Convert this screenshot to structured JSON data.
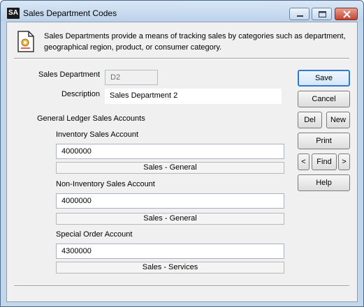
{
  "window": {
    "badge": "SA",
    "title": "Sales Department Codes"
  },
  "info": {
    "text": "Sales Departments provide a means of tracking sales by categories such as department, geographical region, product, or consumer category.",
    "icon": "document-gear-icon"
  },
  "form": {
    "sales_department_label": "Sales Department",
    "sales_department_value": "D2",
    "description_label": "Description",
    "description_value": "Sales Department 2",
    "gl_section_label": "General Ledger Sales Accounts",
    "inventory": {
      "label": "Inventory Sales Account",
      "value": "4000000",
      "account_name": "Sales - General"
    },
    "non_inventory": {
      "label": "Non-Inventory Sales Account",
      "value": "4000000",
      "account_name": "Sales - General"
    },
    "special_order": {
      "label": "Special Order Account",
      "value": "4300000",
      "account_name": "Sales - Services"
    }
  },
  "buttons": {
    "save": "Save",
    "cancel": "Cancel",
    "del": "Del",
    "new": "New",
    "print": "Print",
    "prev": "<",
    "find": "Find",
    "next": ">",
    "help": "Help"
  }
}
